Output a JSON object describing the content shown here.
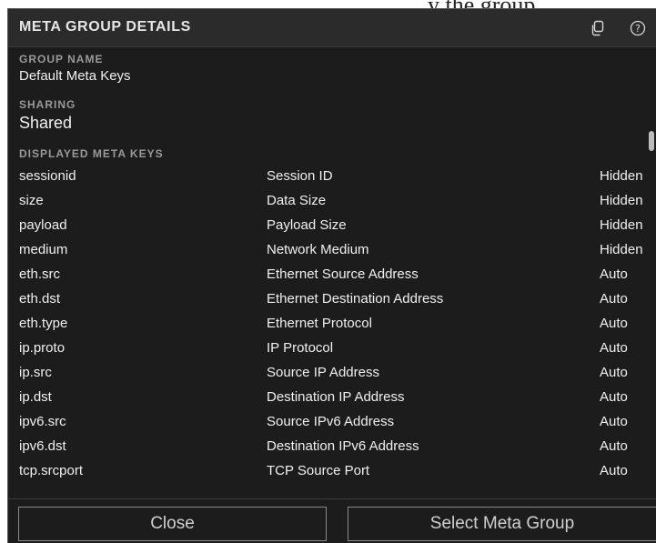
{
  "background": {
    "partial_text": "y the group"
  },
  "dialog": {
    "title": "META GROUP DETAILS",
    "icons": {
      "copy": "copy-icon",
      "help": "help-icon"
    },
    "group_name": {
      "label": "GROUP NAME",
      "value": "Default Meta Keys"
    },
    "sharing": {
      "label": "SHARING",
      "value": "Shared"
    },
    "meta_keys_label": "DISPLAYED META KEYS",
    "meta_keys": [
      {
        "key": "sessionid",
        "description": "Session ID",
        "visibility": "Hidden"
      },
      {
        "key": "size",
        "description": "Data Size",
        "visibility": "Hidden"
      },
      {
        "key": "payload",
        "description": "Payload Size",
        "visibility": "Hidden"
      },
      {
        "key": "medium",
        "description": "Network Medium",
        "visibility": "Hidden"
      },
      {
        "key": "eth.src",
        "description": "Ethernet Source Address",
        "visibility": "Auto"
      },
      {
        "key": "eth.dst",
        "description": "Ethernet Destination Address",
        "visibility": "Auto"
      },
      {
        "key": "eth.type",
        "description": "Ethernet Protocol",
        "visibility": "Auto"
      },
      {
        "key": "ip.proto",
        "description": "IP Protocol",
        "visibility": "Auto"
      },
      {
        "key": "ip.src",
        "description": "Source IP Address",
        "visibility": "Auto"
      },
      {
        "key": "ip.dst",
        "description": "Destination IP Address",
        "visibility": "Auto"
      },
      {
        "key": "ipv6.src",
        "description": "Source IPv6 Address",
        "visibility": "Auto"
      },
      {
        "key": "ipv6.dst",
        "description": "Destination IPv6 Address",
        "visibility": "Auto"
      },
      {
        "key": "tcp.srcport",
        "description": "TCP Source Port",
        "visibility": "Auto"
      }
    ],
    "buttons": {
      "close": "Close",
      "select": "Select Meta Group"
    }
  },
  "colors": {
    "panel_bg": "#1c1c1c",
    "header_bg": "#2b2b2b",
    "label": "#9a9a9a",
    "text": "#f0f0f0",
    "button_border": "#8a8a8a"
  }
}
